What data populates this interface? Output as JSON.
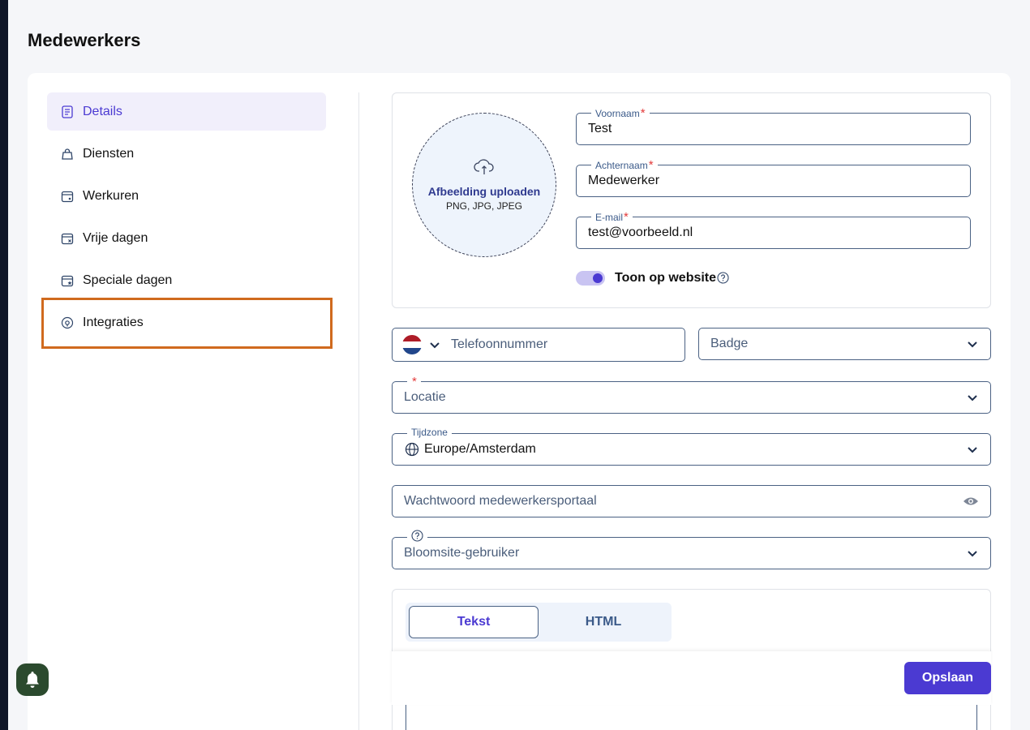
{
  "page": {
    "title": "Medewerkers"
  },
  "sidebar": {
    "items": [
      {
        "label": "Details",
        "icon": "document-icon",
        "active": true
      },
      {
        "label": "Diensten",
        "icon": "bag-icon"
      },
      {
        "label": "Werkuren",
        "icon": "calendar-clock-icon"
      },
      {
        "label": "Vrije dagen",
        "icon": "calendar-x-icon"
      },
      {
        "label": "Speciale dagen",
        "icon": "calendar-star-icon"
      },
      {
        "label": "Integraties",
        "icon": "plug-icon"
      }
    ]
  },
  "profile": {
    "upload_title": "Afbeelding uploaden",
    "upload_formats": "PNG, JPG, JPEG",
    "first_name": {
      "label": "Voornaam",
      "required": "*",
      "value": "Test"
    },
    "last_name": {
      "label": "Achternaam",
      "required": "*",
      "value": "Medewerker"
    },
    "email": {
      "label": "E-mail",
      "required": "*",
      "value": "test@voorbeeld.nl"
    },
    "show_on_website": {
      "label": "Toon op website",
      "enabled": true
    }
  },
  "form": {
    "phone_placeholder": "Telefoonnummer",
    "badge_placeholder": "Badge",
    "location_required": "*",
    "location_placeholder": "Locatie",
    "timezone": {
      "label": "Tijdzone",
      "value": "Europe/Amsterdam"
    },
    "password_placeholder": "Wachtwoord medewerkersportaal",
    "bloomsite_placeholder": "Bloomsite-gebruiker"
  },
  "editor": {
    "tab_text": "Tekst",
    "tab_html": "HTML"
  },
  "actions": {
    "save_label": "Opslaan"
  },
  "colors": {
    "accent": "#4b3ad2",
    "highlight": "#d06a1e",
    "field_border": "#4a6183"
  }
}
